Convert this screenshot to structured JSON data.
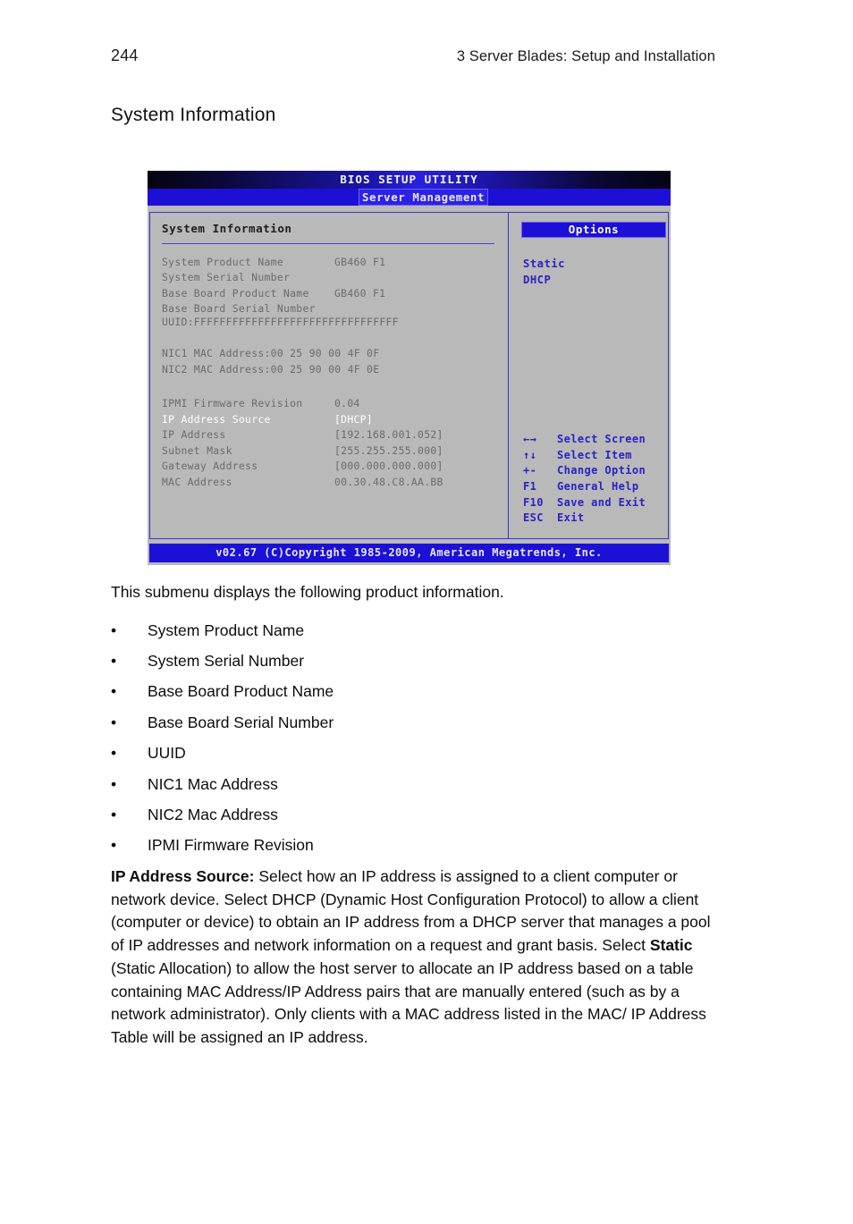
{
  "page": {
    "number": "244",
    "running_head": "3 Server Blades: Setup and Installation",
    "section_title": "System Information"
  },
  "bios": {
    "title": "BIOS SETUP UTILITY",
    "active_tab": "Server Management",
    "panel_heading": "System Information",
    "rows": [
      {
        "label": "System Product Name",
        "value": "GB460 F1"
      },
      {
        "label": "System Serial Number",
        "value": ""
      },
      {
        "label": "Base Board Product Name",
        "value": "GB460 F1"
      },
      {
        "label": "Base Board Serial Number",
        "value": ""
      }
    ],
    "uuid_line": "UUID:FFFFFFFFFFFFFFFFFFFFFFFFFFFFFFFF",
    "nic_lines": [
      "NIC1 MAC Address:00 25 90 00 4F 0F",
      "NIC2 MAC Address:00 25 90 00 4F 0E"
    ],
    "rows2": [
      {
        "label": "IPMI Firmware Revision",
        "value": "0.04",
        "selected": false
      },
      {
        "label": "IP Address Source",
        "value": "[DHCP]",
        "selected": true
      },
      {
        "label": "IP Address",
        "value": "[192.168.001.052]",
        "selected": false
      },
      {
        "label": "Subnet Mask",
        "value": "[255.255.255.000]",
        "selected": false
      },
      {
        "label": "Gateway Address",
        "value": "[000.000.000.000]",
        "selected": false
      },
      {
        "label": "MAC Address",
        "value": "00.30.48.C8.AA.BB",
        "selected": false
      }
    ],
    "options_title": "Options",
    "options": [
      "Static",
      "DHCP"
    ],
    "keys": [
      {
        "key": "←→",
        "desc": "Select Screen"
      },
      {
        "key": "↑↓",
        "desc": "Select Item"
      },
      {
        "key": "+-",
        "desc": "Change Option"
      },
      {
        "key": "F1",
        "desc": "General Help"
      },
      {
        "key": "F10",
        "desc": "Save and Exit"
      },
      {
        "key": "ESC",
        "desc": "Exit"
      }
    ],
    "footer": "v02.67 (C)Copyright 1985-2009, American Megatrends, Inc.",
    "colors": {
      "menu_blue": "#1c10d6",
      "panel_gray": "#b9b9b9",
      "option_text": "#2a22c4",
      "selected_text": "#ffffff"
    }
  },
  "content": {
    "intro": "This submenu displays the following product information.",
    "bullet_marker": "•",
    "bullets": [
      "System Product Name",
      "System Serial Number",
      "Base Board Product Name",
      "Base Board Serial Number",
      "UUID",
      "NIC1 Mac Address",
      "NIC2 Mac Address",
      "IPMI Firmware Revision"
    ],
    "paragraph": {
      "term": "IP Address Source:",
      "part1": " Select how an IP address is assigned to a client computer or network device. Select DHCP (Dynamic Host Configuration Protocol) to allow a client (computer or device) to obtain an IP address from a DHCP server that manages a pool of IP addresses and network information on a request and grant basis. Select ",
      "emphasis": "Static",
      "part2": " (Static Allocation) to allow the host server to allocate an IP address based on a table containing MAC Address/IP Address pairs that are manually entered (such as by a network administrator). Only clients with a MAC address listed in the MAC/ IP Address Table will be assigned an IP address."
    }
  }
}
